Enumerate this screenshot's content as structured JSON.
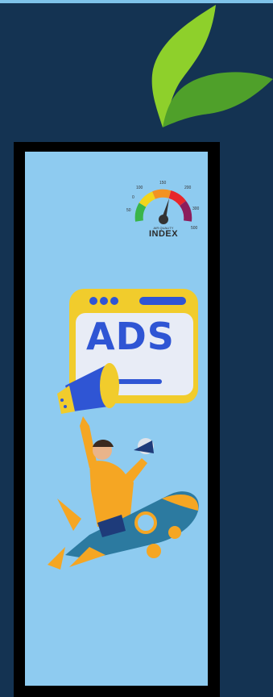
{
  "colors": {
    "background": "#143352",
    "top_strip": "#7fc3ea",
    "frame": "#000000",
    "panel": "#8ecbf0",
    "leaf_light": "#8ed02b",
    "leaf_dark": "#4fa02a",
    "ads_blue": "#2f55d4",
    "ads_yellow": "#f1cc2c",
    "shirt_orange": "#f5a623"
  },
  "icons": {
    "logo": "leaf-logo-icon",
    "gauge": "air-quality-gauge-icon",
    "megaphone": "megaphone-icon",
    "rocket": "rocket-icon"
  },
  "gauge": {
    "ticks": [
      "0",
      "50",
      "100",
      "150",
      "200",
      "300",
      "500"
    ],
    "label_small": "AIR QUALITY",
    "label_main": "INDEX"
  },
  "ad": {
    "text": "ADS"
  }
}
